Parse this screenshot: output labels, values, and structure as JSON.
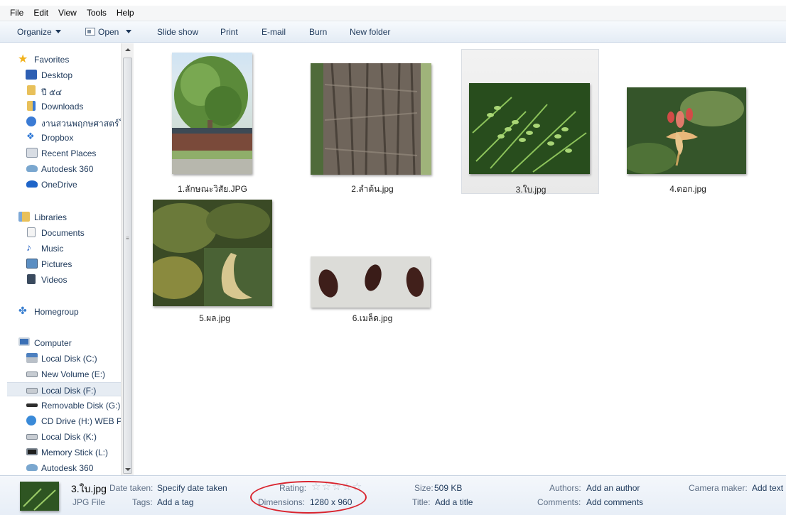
{
  "menu": [
    "File",
    "Edit",
    "View",
    "Tools",
    "Help"
  ],
  "toolbar": {
    "organize": "Organize",
    "open": "Open",
    "slideshow": "Slide show",
    "print": "Print",
    "email": "E-mail",
    "burn": "Burn",
    "new_folder": "New folder"
  },
  "nav": {
    "favorites": "Favorites",
    "desktop": "Desktop",
    "folder_year": "ปี ๕๔",
    "downloads": "Downloads",
    "botanical": "งานสวนพฤกษศาสตร์โ",
    "dropbox": "Dropbox",
    "recent": "Recent Places",
    "autodesk1": "Autodesk 360",
    "onedrive": "OneDrive",
    "libraries": "Libraries",
    "documents": "Documents",
    "music": "Music",
    "pictures": "Pictures",
    "videos": "Videos",
    "homegroup": "Homegroup",
    "computer": "Computer",
    "disk_c": "Local Disk (C:)",
    "disk_e": "New Volume (E:)",
    "disk_f": "Local Disk (F:)",
    "disk_g": "Removable Disk (G:)",
    "disk_h": "CD Drive (H:) WEB P",
    "disk_k": "Local Disk (K:)",
    "disk_l": "Memory Stick (L:)",
    "autodesk2": "Autodesk 360"
  },
  "files": [
    {
      "name": "1.ลักษณะวิสัย.JPG"
    },
    {
      "name": "2.ลำต้น.jpg"
    },
    {
      "name": "3.ใบ.jpg"
    },
    {
      "name": "4.ดอก.jpg"
    },
    {
      "name": "5.ผล.jpg"
    },
    {
      "name": "6.เมล็ด.jpg"
    }
  ],
  "details": {
    "filename": "3.ใบ.jpg",
    "filetype": "JPG File",
    "date_taken_label": "Date taken:",
    "date_taken_value": "Specify date taken",
    "tags_label": "Tags:",
    "tags_value": "Add a tag",
    "rating_label": "Rating:",
    "rating_stars": 0,
    "dimensions_label": "Dimensions:",
    "dimensions_value": "1280 x 960",
    "size_label": "Size:",
    "size_value": "509 KB",
    "title_label": "Title:",
    "title_value": "Add a title",
    "authors_label": "Authors:",
    "authors_value": "Add an author",
    "comments_label": "Comments:",
    "comments_value": "Add comments",
    "camera_label": "Camera maker:",
    "camera_value": "Add text"
  },
  "colors": {
    "annotation": "#d9232d",
    "selection": "#e9e9e9",
    "text": "#1e395b"
  }
}
